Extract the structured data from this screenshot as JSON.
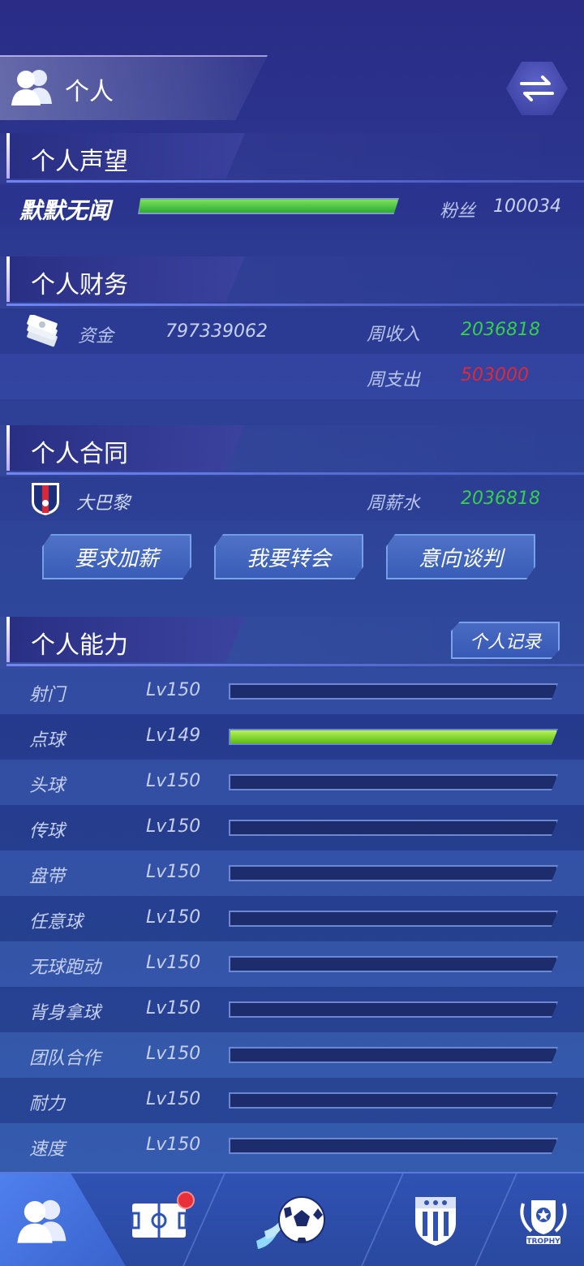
{
  "header": {
    "title": "个人",
    "people_icon": "people-icon",
    "switch_icon": "swap-arrows-icon"
  },
  "reputation": {
    "section_title": "个人声望",
    "rank": "默默无闻",
    "progress": 1.0,
    "fans_label": "粉丝",
    "fans_value": "100034"
  },
  "finance": {
    "section_title": "个人财务",
    "money_icon": "cash-icon",
    "funds_label": "资金",
    "funds_value": "797339062",
    "weekly_income_label": "周收入",
    "weekly_income_value": "2036818",
    "weekly_expense_label": "周支出",
    "weekly_expense_value": "503000"
  },
  "contract": {
    "section_title": "个人合同",
    "club_icon": "club-crest-icon",
    "club_name": "大巴黎",
    "weekly_salary_label": "周薪水",
    "weekly_salary_value": "2036818",
    "buttons": [
      "要求加薪",
      "我要转会",
      "意向谈判"
    ]
  },
  "abilities": {
    "section_title": "个人能力",
    "record_button": "个人记录",
    "items": [
      {
        "name": "射门",
        "level": "Lv150",
        "progress": 0
      },
      {
        "name": "点球",
        "level": "Lv149",
        "progress": 1.0
      },
      {
        "name": "头球",
        "level": "Lv150",
        "progress": 0
      },
      {
        "name": "传球",
        "level": "Lv150",
        "progress": 0
      },
      {
        "name": "盘带",
        "level": "Lv150",
        "progress": 0
      },
      {
        "name": "任意球",
        "level": "Lv150",
        "progress": 0
      },
      {
        "name": "无球跑动",
        "level": "Lv150",
        "progress": 0
      },
      {
        "name": "背身拿球",
        "level": "Lv150",
        "progress": 0
      },
      {
        "name": "团队合作",
        "level": "Lv150",
        "progress": 0
      },
      {
        "name": "耐力",
        "level": "Lv150",
        "progress": 0
      },
      {
        "name": "速度",
        "level": "Lv150",
        "progress": 0
      }
    ]
  },
  "bottom_nav": {
    "items": [
      "people-icon",
      "pitch-icon",
      "football-icon",
      "club-shield-icon",
      "trophy-icon"
    ],
    "trophy_text": "TROPHY",
    "notification_on": "pitch-icon"
  },
  "colors": {
    "income": "#35d04a",
    "expense": "#e02836",
    "bar_fill": "#7cd63a"
  }
}
